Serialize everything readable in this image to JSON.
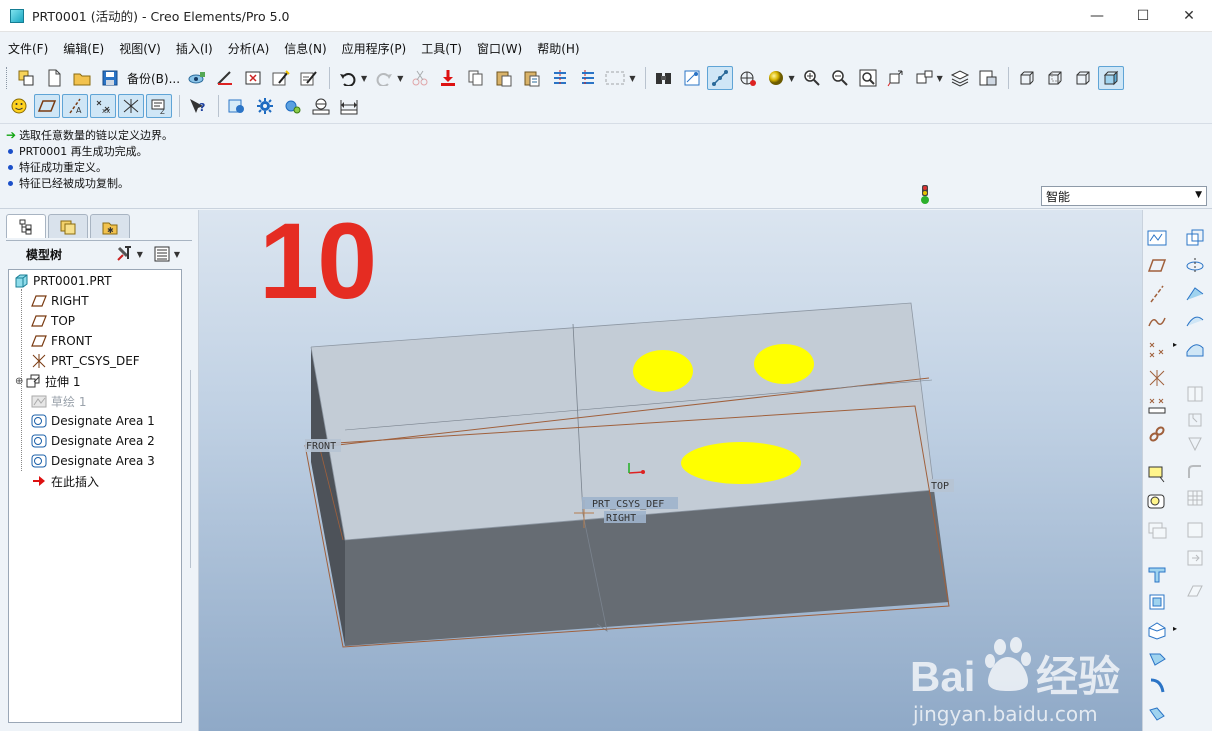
{
  "window": {
    "title": "PRT0001 (活动的) - Creo Elements/Pro 5.0",
    "controls": {
      "minimize": "—",
      "maximize": "☐",
      "close": "✕"
    }
  },
  "menu": [
    "文件(F)",
    "编辑(E)",
    "视图(V)",
    "插入(I)",
    "分析(A)",
    "信息(N)",
    "应用程序(P)",
    "工具(T)",
    "窗口(W)",
    "帮助(H)"
  ],
  "toolbar": {
    "backup_label": "备份(B)...",
    "datum_plane_display_on": true
  },
  "messages": [
    {
      "type": "prompt",
      "text": "选取任意数量的链以定义边界。"
    },
    {
      "type": "info",
      "text": "PRT0001 再生成功完成。"
    },
    {
      "type": "info",
      "text": "特征成功重定义。"
    },
    {
      "type": "info",
      "text": "特征已经被成功复制。"
    }
  ],
  "filter": {
    "selected": "智能"
  },
  "model_tree": {
    "title": "模型树",
    "items": [
      {
        "label": "PRT0001.PRT",
        "icon": "part-icon",
        "dim": false
      },
      {
        "label": "RIGHT",
        "icon": "datum-plane-icon",
        "dim": false
      },
      {
        "label": "TOP",
        "icon": "datum-plane-icon",
        "dim": false
      },
      {
        "label": "FRONT",
        "icon": "datum-plane-icon",
        "dim": false
      },
      {
        "label": "PRT_CSYS_DEF",
        "icon": "csys-icon",
        "dim": false
      },
      {
        "label": "拉伸 1",
        "icon": "extrude-icon",
        "dim": false
      },
      {
        "label": "草绘 1",
        "icon": "sketch-icon",
        "dim": true
      },
      {
        "label": "Designate Area 1",
        "icon": "designate-area-icon",
        "dim": false
      },
      {
        "label": "Designate Area 2",
        "icon": "designate-area-icon",
        "dim": false
      },
      {
        "label": "Designate Area 3",
        "icon": "designate-area-icon",
        "dim": false
      },
      {
        "label": "在此插入",
        "icon": "insert-here-arrow-icon",
        "dim": false
      }
    ]
  },
  "viewport": {
    "step_number": "10",
    "datum_labels": {
      "front": "FRONT",
      "top": "TOP",
      "right": "RIGHT",
      "csys": "PRT_CSYS_DEF"
    },
    "colors": {
      "top_face": "#c3ccd6",
      "front_face": "#666c73",
      "side_face": "#4d5259",
      "area_fill": "#ffff00",
      "datum_edge": "#a0603c",
      "step_number": "#e52c22"
    }
  },
  "watermark": {
    "brand": "Baidu经验",
    "url": "jingyan.baidu.com"
  }
}
